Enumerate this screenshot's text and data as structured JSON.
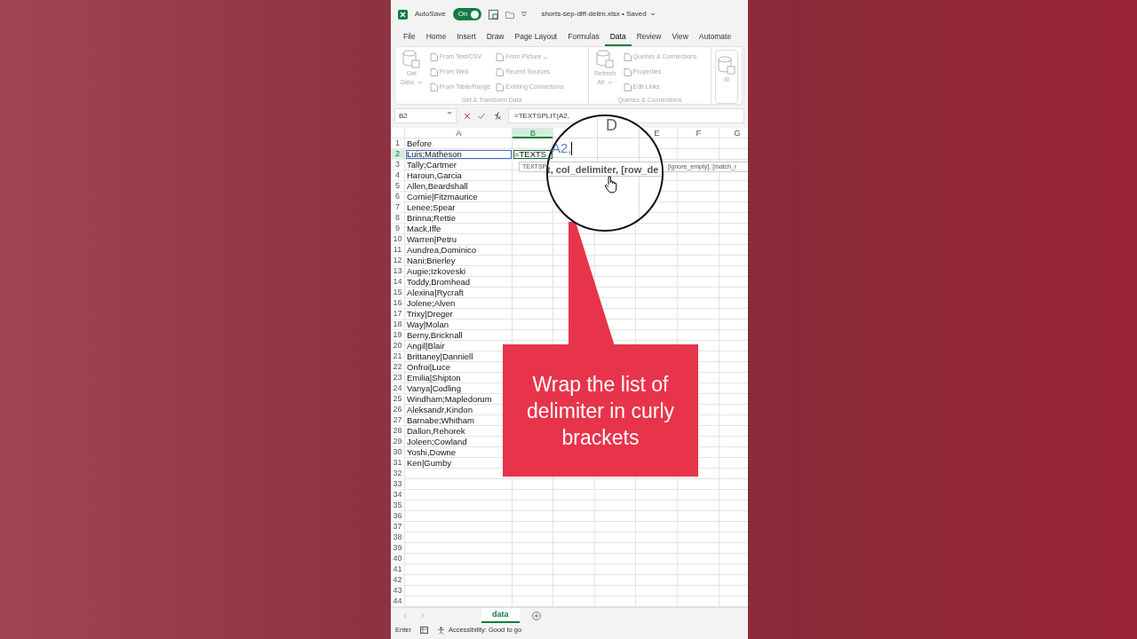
{
  "title_bar": {
    "autosave_label": "AutoSave",
    "autosave_toggle": {
      "label": "On",
      "on": true
    },
    "file_title": "shorts-sep-diff-delim.xlsx • Saved"
  },
  "menu_tabs": [
    {
      "label": "File",
      "selected": false
    },
    {
      "label": "Home",
      "selected": false
    },
    {
      "label": "Insert",
      "selected": false
    },
    {
      "label": "Draw",
      "selected": false
    },
    {
      "label": "Page Layout",
      "selected": false
    },
    {
      "label": "Formulas",
      "selected": false
    },
    {
      "label": "Data",
      "selected": true
    },
    {
      "label": "Review",
      "selected": false
    },
    {
      "label": "View",
      "selected": false
    },
    {
      "label": "Automate",
      "selected": false
    }
  ],
  "ribbon": {
    "groups": [
      {
        "label": "Get & Transform Data",
        "disabled": true,
        "big_button": {
          "lines": [
            "Get",
            "Data"
          ],
          "dropdown": true
        },
        "columns": [
          [
            {
              "label": "From Text/CSV",
              "dropdown": false
            },
            {
              "label": "From Web",
              "dropdown": false
            },
            {
              "label": "From Table/Range",
              "dropdown": false
            }
          ],
          [
            {
              "label": "From Picture",
              "dropdown": true
            },
            {
              "label": "Recent Sources",
              "dropdown": false
            },
            {
              "label": "Existing Connections",
              "dropdown": false
            }
          ]
        ]
      },
      {
        "label": "Queries & Connections",
        "disabled": true,
        "big_button": {
          "lines": [
            "Refresh",
            "All"
          ],
          "dropdown": true
        },
        "columns": [
          [
            {
              "label": "Queries & Connections",
              "dropdown": false
            },
            {
              "label": "Properties",
              "dropdown": false
            },
            {
              "label": "Edit Links",
              "dropdown": false
            }
          ]
        ]
      },
      {
        "disabled": true,
        "big_button": {
          "lines": [
            "St"
          ],
          "dropdown": false
        }
      }
    ]
  },
  "formula_bar": {
    "name_box": "B2",
    "formula": "=TEXTSPLIT(A2,"
  },
  "columns": [
    {
      "kind": "header",
      "label": "A",
      "selected": false
    },
    {
      "kind": "header",
      "label": "B",
      "selected": true
    },
    {
      "kind": "covered"
    },
    {
      "kind": "covered"
    },
    {
      "kind": "header",
      "label": "E",
      "selected": false
    },
    {
      "kind": "header",
      "label": "F",
      "selected": false
    },
    {
      "kind": "header",
      "label": "G",
      "selected": false
    }
  ],
  "rows": [
    {
      "number": "1",
      "a": "Before",
      "selected": false
    },
    {
      "number": "2",
      "a": "Luis;Matheson",
      "b": "=TEXTS",
      "selected": true
    },
    {
      "number": "3",
      "a": "Tally;Cartmer",
      "selected": false
    },
    {
      "number": "4",
      "a": "Haroun,Garcia",
      "selected": false
    },
    {
      "number": "5",
      "a": "Allen,Beardshall",
      "selected": false
    },
    {
      "number": "6",
      "a": "Cornie|Fitzmaurice",
      "selected": false
    },
    {
      "number": "7",
      "a": "Lenee;Spear",
      "selected": false
    },
    {
      "number": "8",
      "a": "Brinna;Rettie",
      "selected": false
    },
    {
      "number": "9",
      "a": "Mack,Iffe",
      "selected": false
    },
    {
      "number": "10",
      "a": "Warren|Petru",
      "selected": false
    },
    {
      "number": "11",
      "a": "Aundrea,Dominico",
      "selected": false
    },
    {
      "number": "12",
      "a": "Nani;Brierley",
      "selected": false
    },
    {
      "number": "13",
      "a": "Augie;Izkoveski",
      "selected": false
    },
    {
      "number": "14",
      "a": "Toddy,Bromhead",
      "selected": false
    },
    {
      "number": "15",
      "a": "Alexina|Rycraft",
      "selected": false
    },
    {
      "number": "16",
      "a": "Jolene;Alven",
      "selected": false
    },
    {
      "number": "17",
      "a": "Trixy|Dreger",
      "selected": false
    },
    {
      "number": "18",
      "a": "Way|Molan",
      "selected": false
    },
    {
      "number": "19",
      "a": "Berny,Bricknall",
      "selected": false
    },
    {
      "number": "20",
      "a": "Angil|Blair",
      "selected": false
    },
    {
      "number": "21",
      "a": "Brittaney|Danniell",
      "selected": false
    },
    {
      "number": "22",
      "a": "Onfroi|Luce",
      "selected": false
    },
    {
      "number": "23",
      "a": "Emilia|Shipton",
      "selected": false
    },
    {
      "number": "24",
      "a": "Vanya|Codling",
      "selected": false
    },
    {
      "number": "25",
      "a": "Windham;Mapledorum",
      "selected": false
    },
    {
      "number": "26",
      "a": "Aleksandr,Kindon",
      "selected": false
    },
    {
      "number": "27",
      "a": "Barnabe;Whitham",
      "selected": false
    },
    {
      "number": "28",
      "a": "Dallon,Rehorek",
      "selected": false
    },
    {
      "number": "29",
      "a": "Joleen;Cowland",
      "selected": false
    },
    {
      "number": "30",
      "a": "Yoshi,Downe",
      "selected": false
    },
    {
      "number": "31",
      "a": "Ken|Gumby",
      "selected": false
    },
    {
      "number": "32",
      "selected": false
    },
    {
      "number": "33",
      "selected": false
    },
    {
      "number": "34",
      "selected": false
    },
    {
      "number": "35",
      "selected": false
    },
    {
      "number": "36",
      "selected": false
    },
    {
      "number": "37",
      "selected": false
    },
    {
      "number": "38",
      "selected": false
    },
    {
      "number": "39",
      "selected": false
    },
    {
      "number": "40",
      "selected": false
    },
    {
      "number": "41",
      "selected": false
    },
    {
      "number": "42",
      "selected": false
    },
    {
      "number": "43",
      "selected": false
    },
    {
      "number": "44",
      "selected": false
    }
  ],
  "tooltip": {
    "left_text": "TEXTSP",
    "right_text": "[ignore_empty], [match_r"
  },
  "magnifier": {
    "column_header": "D",
    "cell_text": "A2,",
    "tooltip_text": "t, col_delimiter, [row_de"
  },
  "callout": {
    "text": "Wrap the list of delimiter in curly brackets"
  },
  "sheet_tabs": [
    {
      "label": "data",
      "selected": true
    }
  ],
  "status_bar": {
    "mode": "Enter",
    "accessibility": "Accessibility: Good to go"
  }
}
